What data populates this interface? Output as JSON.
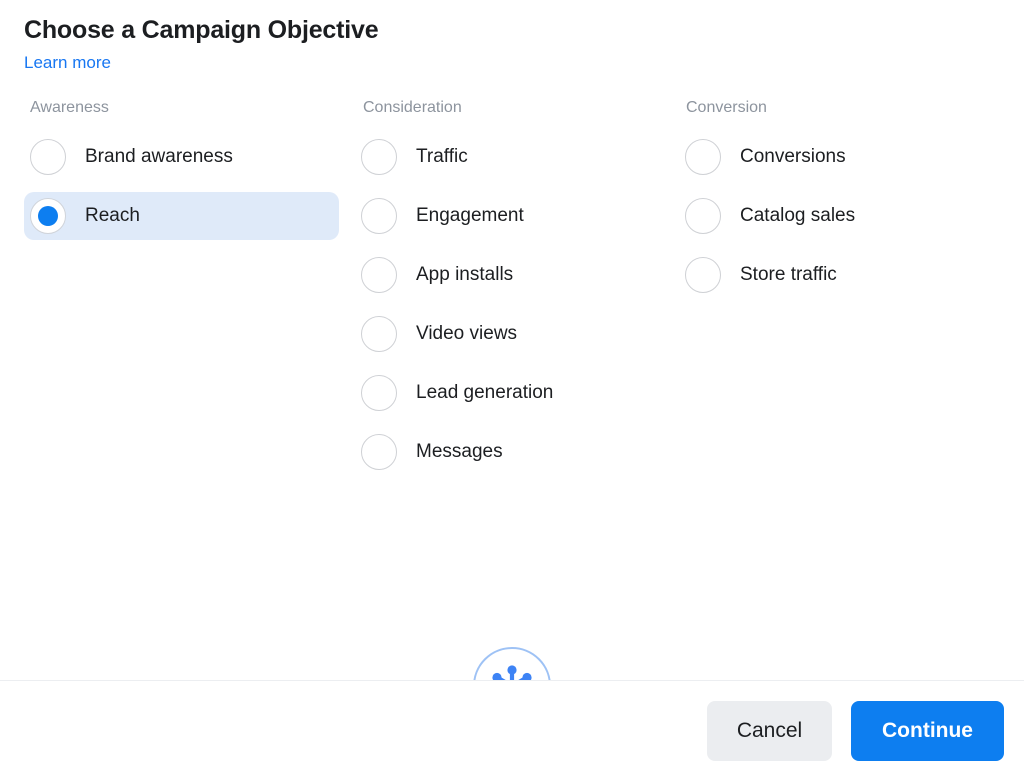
{
  "dialog": {
    "title": "Choose a Campaign Objective",
    "learn_more_label": "Learn more"
  },
  "columns": [
    {
      "id": "awareness",
      "heading": "Awareness",
      "options": [
        {
          "label": "Brand awareness",
          "selected": false
        },
        {
          "label": "Reach",
          "selected": true
        }
      ]
    },
    {
      "id": "consideration",
      "heading": "Consideration",
      "options": [
        {
          "label": "Traffic",
          "selected": false
        },
        {
          "label": "Engagement",
          "selected": false
        },
        {
          "label": "App installs",
          "selected": false
        },
        {
          "label": "Video views",
          "selected": false
        },
        {
          "label": "Lead generation",
          "selected": false
        },
        {
          "label": "Messages",
          "selected": false
        }
      ]
    },
    {
      "id": "conversion",
      "heading": "Conversion",
      "options": [
        {
          "label": "Conversions",
          "selected": false
        },
        {
          "label": "Catalog sales",
          "selected": false
        },
        {
          "label": "Store traffic",
          "selected": false
        }
      ]
    }
  ],
  "badge": {
    "icon": "hub-spokes-icon"
  },
  "footer": {
    "cancel_label": "Cancel",
    "continue_label": "Continue"
  },
  "colors": {
    "accent_blue": "#0d7ef0",
    "link_blue": "#1877f2",
    "selected_row_bg": "#dfeaf9",
    "cancel_bg": "#ebedf0",
    "heading_gray": "#8d949e",
    "text_dark": "#1c1e21",
    "badge_border": "#9ec2f5"
  }
}
